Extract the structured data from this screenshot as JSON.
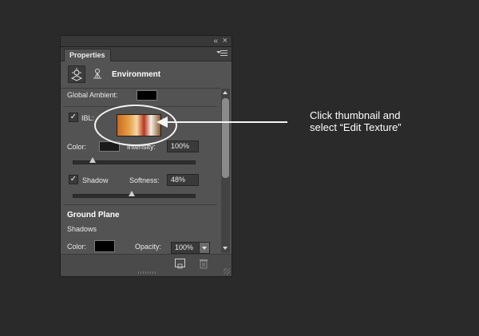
{
  "panel": {
    "tab_label": "Properties",
    "header_title": "Environment",
    "global_ambient_label": "Global Ambient:",
    "ibl_label": "IBL:",
    "color_label": "Color:",
    "intensity_label": "Intensity:",
    "intensity_value": "100%",
    "intensity_level": 0.16,
    "shadow_label": "Shadow",
    "softness_label": "Softness:",
    "softness_value": "48%",
    "softness_level": 0.48,
    "ground_plane_heading": "Ground Plane",
    "shadows_label": "Shadows",
    "ground_color_label": "Color:",
    "opacity_label": "Opacity:",
    "opacity_value": "100%",
    "ibl_checked": "✓",
    "shadow_checked": "✓"
  },
  "icons": {
    "collapse": "«",
    "close": "×",
    "thumb_menu": "▶"
  },
  "callout": {
    "line1": "Click thumbnail and",
    "line2": "select “Edit Texture”"
  },
  "colors": {
    "background": "#2a2a2a",
    "panel": "#535353",
    "callout": "#f4f4f4"
  }
}
